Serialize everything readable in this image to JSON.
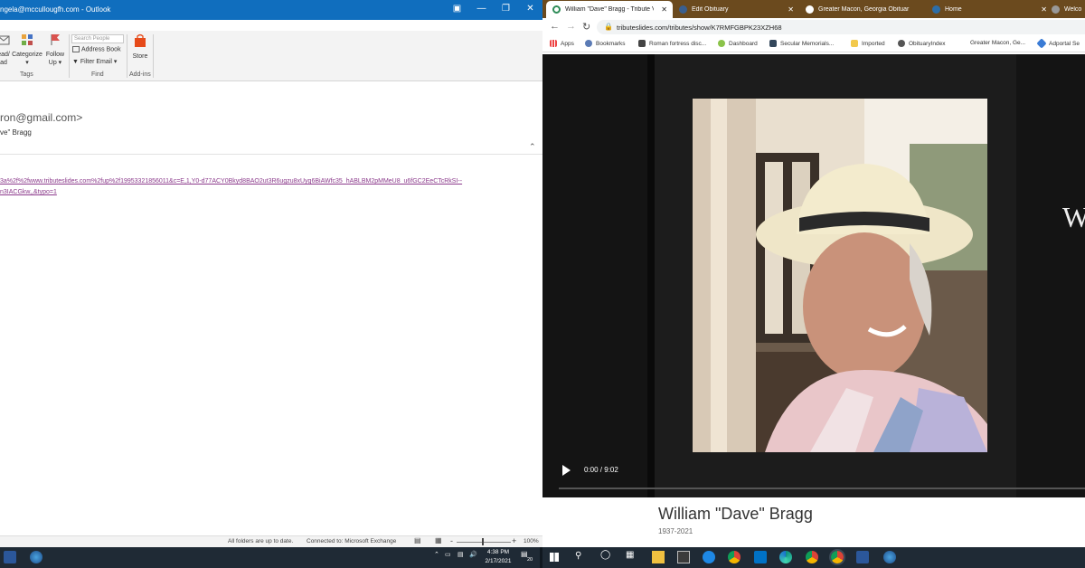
{
  "outlook": {
    "title": "ngela@mccullougfh.com - Outlook",
    "ribbon": {
      "read_unread_line1": "ead/",
      "read_unread_line2": "ad",
      "categorize": "Categorize",
      "follow_up_line1": "Follow",
      "follow_up_line2": "Up",
      "tags_group": "Tags",
      "search_people_placeholder": "Search People",
      "address_book": "Address Book",
      "filter_email": "Filter Email",
      "find_group": "Find",
      "store": "Store",
      "addins_group": "Add-ins"
    },
    "message": {
      "sender": "rron@gmail.com>",
      "to_line": "ve\" Bragg",
      "link_line1": "3a%2f%2fwww.tributeslides.com%2fup%2f19953321856011&c=E,1,Y0-d77ACY0Bkyd8BAO2ut3R6ugzu8xUyg6BiAWfc35_hABLBM2pMMeU8_u6fGC2EeCTcRkSI--",
      "link_line2": "n3IACGkw,,&typo=1"
    },
    "status": {
      "folders": "All folders are up to date.",
      "connection": "Connected to: Microsoft Exchange",
      "zoom": "100%"
    }
  },
  "chrome": {
    "tabs": [
      {
        "label": "William \"Dave\" Bragg - Tribute V",
        "active": true
      },
      {
        "label": "Edit Obituary",
        "active": false
      },
      {
        "label": "Greater Macon, Georgia Obituar",
        "active": false
      },
      {
        "label": "Home",
        "active": false
      },
      {
        "label": "Welco",
        "active": false
      }
    ],
    "url": "tributeslides.com/tributes/show/K7RMFGBPK23XZH68",
    "bookmarks": [
      "Apps",
      "Bookmarks",
      "Roman fortress disc...",
      "Dashboard",
      "Secular Memorials...",
      "Imported",
      "ObituaryIndex",
      "Greater Macon, Ge...",
      "Adportal Se"
    ],
    "video": {
      "time": "0:00 / 9:02",
      "side_text": "W",
      "title": "William \"Dave\" Bragg",
      "years": "1937-2021"
    }
  },
  "taskbar": {
    "time": "4:38 PM",
    "date": "2/17/2021",
    "notif_count": "20"
  }
}
